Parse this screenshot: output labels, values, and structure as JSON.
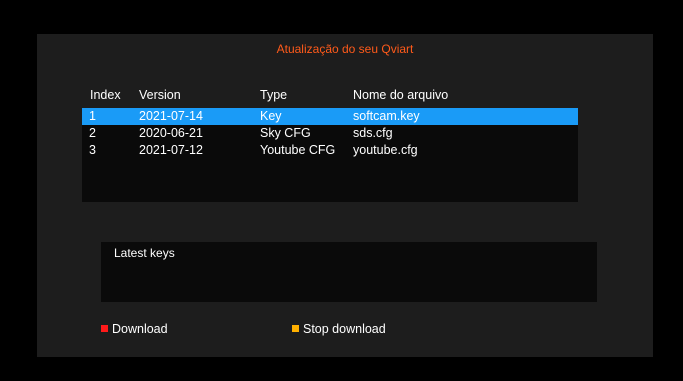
{
  "title": "Atualização do seu Qviart",
  "columns": {
    "index": "Index",
    "version": "Version",
    "type": "Type",
    "file": "Nome do arquivo"
  },
  "rows": [
    {
      "index": "1",
      "version": "2021-07-14",
      "type": "Key",
      "file": "softcam.key",
      "selected": true
    },
    {
      "index": "2",
      "version": "2020-06-21",
      "type": "Sky CFG",
      "file": "sds.cfg",
      "selected": false
    },
    {
      "index": "3",
      "version": "2021-07-12",
      "type": "Youtube CFG",
      "file": "youtube.cfg",
      "selected": false
    }
  ],
  "info": {
    "text": "Latest keys"
  },
  "hints": {
    "download": {
      "label": "Download",
      "color": "#ff1a1a"
    },
    "stop": {
      "label": "Stop download",
      "color": "#ffb000"
    }
  },
  "colors": {
    "title": "#ff5a1a",
    "selection": "#1a9bf7",
    "panel": "#1d1d1d",
    "background": "#000000"
  }
}
